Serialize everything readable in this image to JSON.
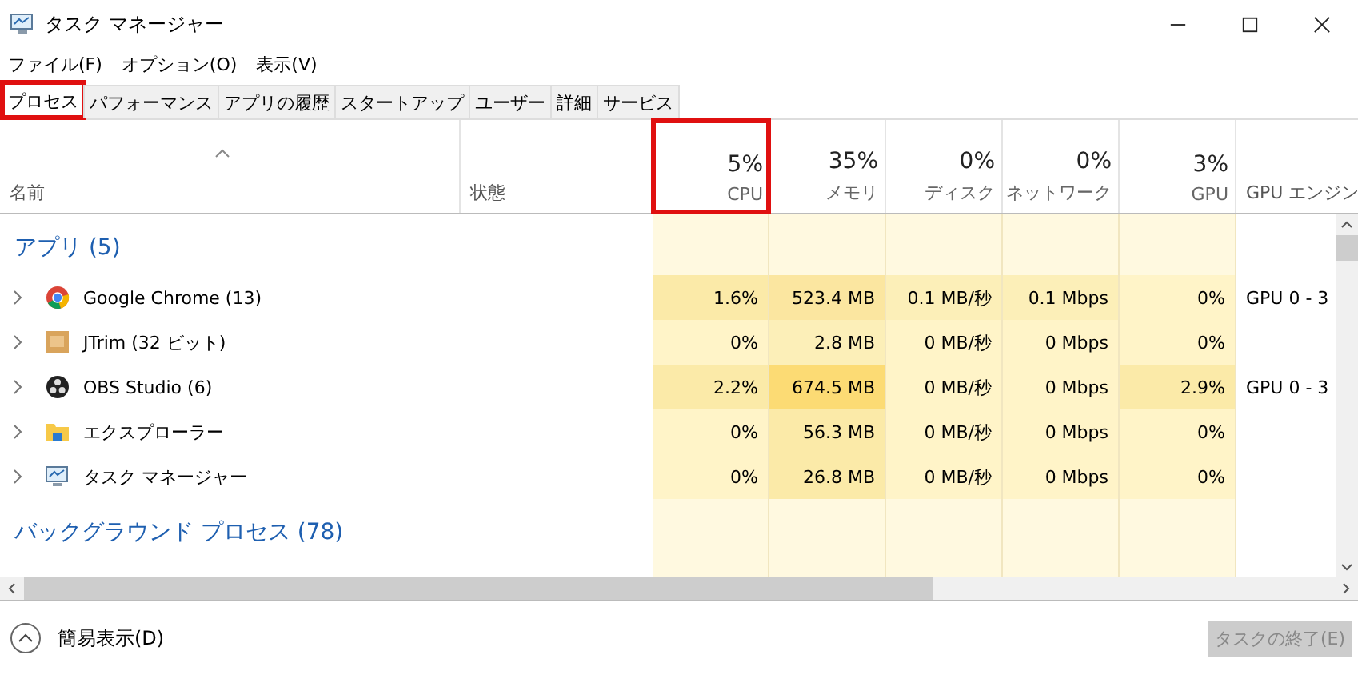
{
  "window": {
    "title": "タスク マネージャー"
  },
  "menu": [
    "ファイル(F)",
    "オプション(O)",
    "表示(V)"
  ],
  "tabs": [
    {
      "label": "プロセス",
      "selected": true,
      "highlighted": true
    },
    {
      "label": "パフォーマンス",
      "selected": false,
      "highlighted": false
    },
    {
      "label": "アプリの履歴",
      "selected": false,
      "highlighted": false
    },
    {
      "label": "スタートアップ",
      "selected": false,
      "highlighted": false
    },
    {
      "label": "ユーザー",
      "selected": false,
      "highlighted": false
    },
    {
      "label": "詳細",
      "selected": false,
      "highlighted": false
    },
    {
      "label": "サービス",
      "selected": false,
      "highlighted": false
    }
  ],
  "columns": [
    {
      "label": "名前"
    },
    {
      "label": "状態"
    },
    {
      "percent": "5%",
      "label": "CPU",
      "highlighted": true
    },
    {
      "percent": "35%",
      "label": "メモリ",
      "highlighted": false
    },
    {
      "percent": "0%",
      "label": "ディスク",
      "highlighted": false
    },
    {
      "percent": "0%",
      "label": "ネットワーク",
      "highlighted": false
    },
    {
      "percent": "3%",
      "label": "GPU",
      "highlighted": false
    },
    {
      "label": "GPU エンジン"
    }
  ],
  "groups": [
    {
      "title": "アプリ (5)",
      "rows": [
        {
          "name": "Google Chrome (13)",
          "kind": "chrome",
          "cells": [
            {
              "text": "1.6%",
              "color": "#fbeaa8"
            },
            {
              "text": "523.4 MB",
              "color": "#fbe6a0"
            },
            {
              "text": "0.1 MB/秒",
              "color": "#fcefb8"
            },
            {
              "text": "0.1 Mbps",
              "color": "#fcefb8"
            },
            {
              "text": "0%",
              "color": "#fff4c8"
            }
          ],
          "engine": "GPU 0 - 3"
        },
        {
          "name": "JTrim (32 ビット)",
          "kind": "jtrim",
          "cells": [
            {
              "text": "0%",
              "color": "#fff4c8"
            },
            {
              "text": "2.8 MB",
              "color": "#fcefb8"
            },
            {
              "text": "0 MB/秒",
              "color": "#fff4c8"
            },
            {
              "text": "0 Mbps",
              "color": "#fff4c8"
            },
            {
              "text": "0%",
              "color": "#fff4c8"
            }
          ]
        },
        {
          "name": "OBS Studio (6)",
          "kind": "obs",
          "cells": [
            {
              "text": "2.2%",
              "color": "#fbeaa8"
            },
            {
              "text": "674.5 MB",
              "color": "#fcdb74"
            },
            {
              "text": "0 MB/秒",
              "color": "#fff4c8"
            },
            {
              "text": "0 Mbps",
              "color": "#fff4c8"
            },
            {
              "text": "2.9%",
              "color": "#fbeaa8"
            }
          ],
          "engine": "GPU 0 - 3"
        },
        {
          "name": "エクスプローラー",
          "kind": "explorer",
          "cells": [
            {
              "text": "0%",
              "color": "#fff4c8"
            },
            {
              "text": "56.3 MB",
              "color": "#fbeaa8"
            },
            {
              "text": "0 MB/秒",
              "color": "#fff4c8"
            },
            {
              "text": "0 Mbps",
              "color": "#fff4c8"
            },
            {
              "text": "0%",
              "color": "#fff4c8"
            }
          ]
        },
        {
          "name": "タスク マネージャー",
          "kind": "taskmgr",
          "cells": [
            {
              "text": "0%",
              "color": "#fff4c8"
            },
            {
              "text": "26.8 MB",
              "color": "#fbeaa8"
            },
            {
              "text": "0 MB/秒",
              "color": "#fff4c8"
            },
            {
              "text": "0 Mbps",
              "color": "#fff4c8"
            },
            {
              "text": "0%",
              "color": "#fff4c8"
            }
          ]
        }
      ]
    },
    {
      "title": "バックグラウンド プロセス (78)"
    }
  ],
  "footer": {
    "toggle": "簡易表示(D)",
    "end_task": {
      "label": "タスクの終了(E)",
      "disabled": true
    }
  }
}
